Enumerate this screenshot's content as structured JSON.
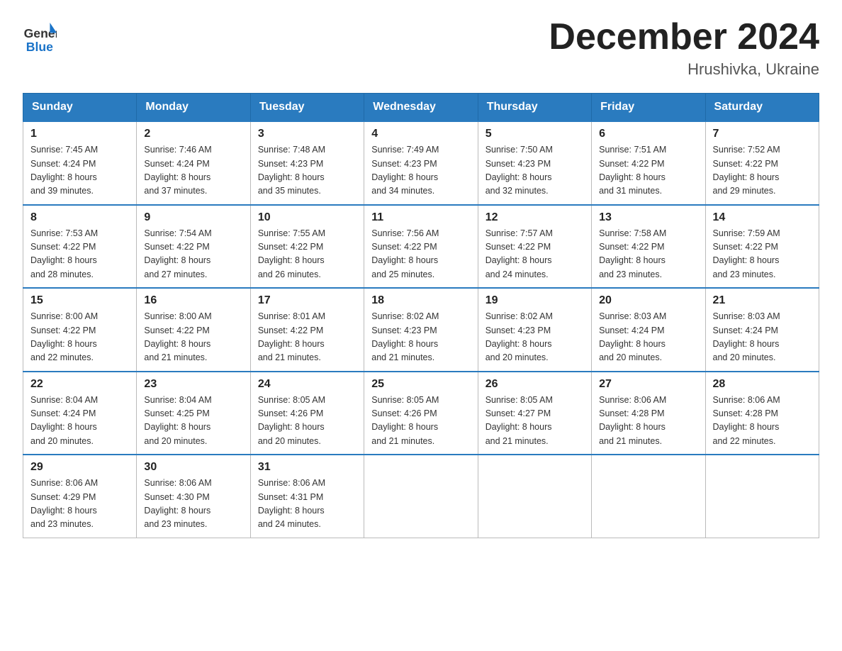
{
  "header": {
    "logo_general": "General",
    "logo_blue": "Blue",
    "month_title": "December 2024",
    "location": "Hrushivka, Ukraine"
  },
  "days_of_week": [
    "Sunday",
    "Monday",
    "Tuesday",
    "Wednesday",
    "Thursday",
    "Friday",
    "Saturday"
  ],
  "weeks": [
    [
      {
        "day": "1",
        "sunrise": "7:45 AM",
        "sunset": "4:24 PM",
        "daylight": "8 hours and 39 minutes."
      },
      {
        "day": "2",
        "sunrise": "7:46 AM",
        "sunset": "4:24 PM",
        "daylight": "8 hours and 37 minutes."
      },
      {
        "day": "3",
        "sunrise": "7:48 AM",
        "sunset": "4:23 PM",
        "daylight": "8 hours and 35 minutes."
      },
      {
        "day": "4",
        "sunrise": "7:49 AM",
        "sunset": "4:23 PM",
        "daylight": "8 hours and 34 minutes."
      },
      {
        "day": "5",
        "sunrise": "7:50 AM",
        "sunset": "4:23 PM",
        "daylight": "8 hours and 32 minutes."
      },
      {
        "day": "6",
        "sunrise": "7:51 AM",
        "sunset": "4:22 PM",
        "daylight": "8 hours and 31 minutes."
      },
      {
        "day": "7",
        "sunrise": "7:52 AM",
        "sunset": "4:22 PM",
        "daylight": "8 hours and 29 minutes."
      }
    ],
    [
      {
        "day": "8",
        "sunrise": "7:53 AM",
        "sunset": "4:22 PM",
        "daylight": "8 hours and 28 minutes."
      },
      {
        "day": "9",
        "sunrise": "7:54 AM",
        "sunset": "4:22 PM",
        "daylight": "8 hours and 27 minutes."
      },
      {
        "day": "10",
        "sunrise": "7:55 AM",
        "sunset": "4:22 PM",
        "daylight": "8 hours and 26 minutes."
      },
      {
        "day": "11",
        "sunrise": "7:56 AM",
        "sunset": "4:22 PM",
        "daylight": "8 hours and 25 minutes."
      },
      {
        "day": "12",
        "sunrise": "7:57 AM",
        "sunset": "4:22 PM",
        "daylight": "8 hours and 24 minutes."
      },
      {
        "day": "13",
        "sunrise": "7:58 AM",
        "sunset": "4:22 PM",
        "daylight": "8 hours and 23 minutes."
      },
      {
        "day": "14",
        "sunrise": "7:59 AM",
        "sunset": "4:22 PM",
        "daylight": "8 hours and 23 minutes."
      }
    ],
    [
      {
        "day": "15",
        "sunrise": "8:00 AM",
        "sunset": "4:22 PM",
        "daylight": "8 hours and 22 minutes."
      },
      {
        "day": "16",
        "sunrise": "8:00 AM",
        "sunset": "4:22 PM",
        "daylight": "8 hours and 21 minutes."
      },
      {
        "day": "17",
        "sunrise": "8:01 AM",
        "sunset": "4:22 PM",
        "daylight": "8 hours and 21 minutes."
      },
      {
        "day": "18",
        "sunrise": "8:02 AM",
        "sunset": "4:23 PM",
        "daylight": "8 hours and 21 minutes."
      },
      {
        "day": "19",
        "sunrise": "8:02 AM",
        "sunset": "4:23 PM",
        "daylight": "8 hours and 20 minutes."
      },
      {
        "day": "20",
        "sunrise": "8:03 AM",
        "sunset": "4:24 PM",
        "daylight": "8 hours and 20 minutes."
      },
      {
        "day": "21",
        "sunrise": "8:03 AM",
        "sunset": "4:24 PM",
        "daylight": "8 hours and 20 minutes."
      }
    ],
    [
      {
        "day": "22",
        "sunrise": "8:04 AM",
        "sunset": "4:24 PM",
        "daylight": "8 hours and 20 minutes."
      },
      {
        "day": "23",
        "sunrise": "8:04 AM",
        "sunset": "4:25 PM",
        "daylight": "8 hours and 20 minutes."
      },
      {
        "day": "24",
        "sunrise": "8:05 AM",
        "sunset": "4:26 PM",
        "daylight": "8 hours and 20 minutes."
      },
      {
        "day": "25",
        "sunrise": "8:05 AM",
        "sunset": "4:26 PM",
        "daylight": "8 hours and 21 minutes."
      },
      {
        "day": "26",
        "sunrise": "8:05 AM",
        "sunset": "4:27 PM",
        "daylight": "8 hours and 21 minutes."
      },
      {
        "day": "27",
        "sunrise": "8:06 AM",
        "sunset": "4:28 PM",
        "daylight": "8 hours and 21 minutes."
      },
      {
        "day": "28",
        "sunrise": "8:06 AM",
        "sunset": "4:28 PM",
        "daylight": "8 hours and 22 minutes."
      }
    ],
    [
      {
        "day": "29",
        "sunrise": "8:06 AM",
        "sunset": "4:29 PM",
        "daylight": "8 hours and 23 minutes."
      },
      {
        "day": "30",
        "sunrise": "8:06 AM",
        "sunset": "4:30 PM",
        "daylight": "8 hours and 23 minutes."
      },
      {
        "day": "31",
        "sunrise": "8:06 AM",
        "sunset": "4:31 PM",
        "daylight": "8 hours and 24 minutes."
      },
      null,
      null,
      null,
      null
    ]
  ],
  "labels": {
    "sunrise_prefix": "Sunrise: ",
    "sunset_prefix": "Sunset: ",
    "daylight_prefix": "Daylight: "
  }
}
